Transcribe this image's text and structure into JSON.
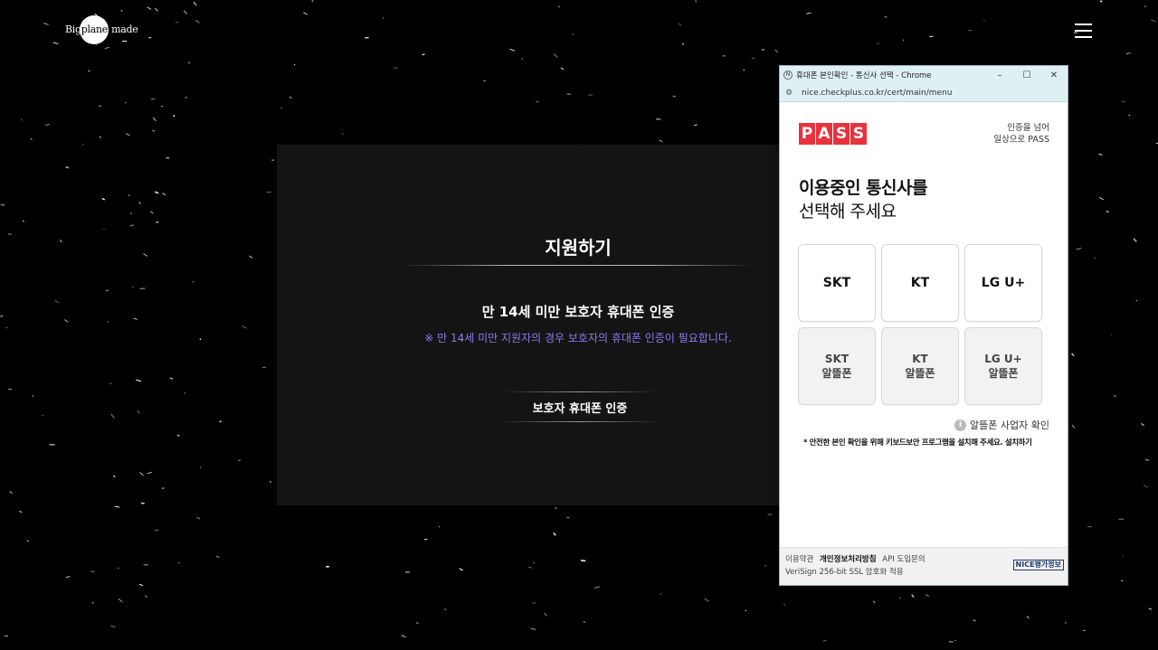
{
  "site": {
    "logo_parts": [
      "Big",
      "planet",
      "made"
    ],
    "menu_icon": "hamburger-icon"
  },
  "panel": {
    "title": "지원하기",
    "guardian_heading": "만 14세 미만 보호자 휴대폰 인증",
    "guardian_note": "※ 만 14세 미만 지원자의 경우 보호자의 휴대폰 인증이 필요합니다.",
    "guardian_button": "보호자 휴대폰 인증",
    "note_color": "#8f7af0"
  },
  "popup": {
    "window_title": "휴대폰 본인확인 - 통신사 선택 - Chrome",
    "controls": [
      "–",
      "☐",
      "✕"
    ],
    "url": "nice.checkplus.co.kr/cert/main/menu",
    "pass_letters": [
      "P",
      "A",
      "S",
      "S"
    ],
    "brand_color": "#e8323c",
    "slogan_line1": "인증을 넘어",
    "slogan_line2": "일상으로 PASS",
    "heading_line1": "이용중인 통신사를",
    "heading_line2": "선택해 주세요",
    "carriers": [
      {
        "name": "SKT",
        "sub": ""
      },
      {
        "name": "KT",
        "sub": ""
      },
      {
        "name": "LG U+",
        "sub": ""
      },
      {
        "name": "SKT",
        "sub": "알뜰폰"
      },
      {
        "name": "KT",
        "sub": "알뜰폰"
      },
      {
        "name": "LG U+",
        "sub": "알뜰폰"
      }
    ],
    "mvno_info": "알뜰폰 사업자 확인",
    "info_icon_glyph": "i",
    "security_note": "* 안전한 본인 확인을 위해 키보드보안 프로그램을 설치해 주세요.",
    "install_link": "설치하기",
    "footer_terms": "이용약관",
    "footer_privacy": "개인정보처리방침",
    "footer_api": "API 도입문의",
    "footer_ssl": "VeriSign 256-bit SSL 암호화 적용",
    "nice_badge": "NICE평가정보"
  }
}
